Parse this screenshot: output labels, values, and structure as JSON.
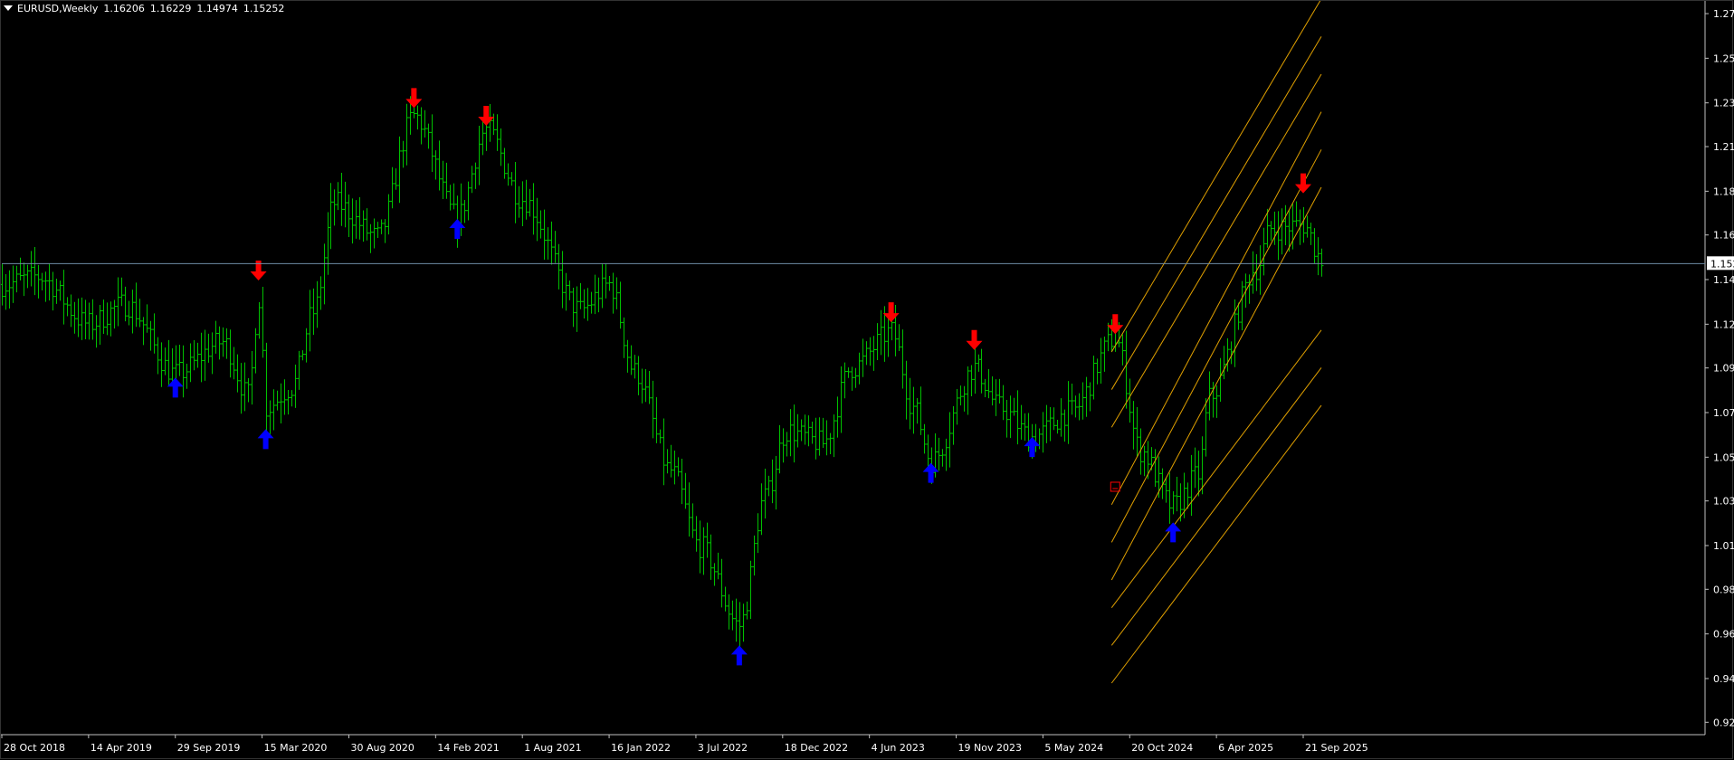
{
  "header": {
    "symbol_timeframe": "EURUSD,Weekly",
    "ohlc": [
      "1.16206",
      "1.16229",
      "1.14974",
      "1.15252"
    ]
  },
  "colors": {
    "background": "#000000",
    "candles": "#00C000",
    "axis": "#C0C0C0",
    "grid_text": "#FFFFFF",
    "current_price_line": "#6E8BA6",
    "up_arrow": "#0000FF",
    "down_arrow": "#FF0000",
    "channel_lines": "#E0A000"
  },
  "chart_data": {
    "type": "ohlc-bar",
    "symbol": "EURUSD",
    "timeframe": "Weekly",
    "current_price": "1.15252",
    "ylim": [
      0.915,
      1.2845
    ],
    "y_ticks": [
      "1.27855",
      "1.25605",
      "1.23355",
      "1.21150",
      "1.18900",
      "1.16695",
      "1.14445",
      "1.12195",
      "1.09990",
      "1.07740",
      "1.05490",
      "1.03285",
      "1.01035",
      "0.98830",
      "0.96580",
      "0.94330",
      "0.92125"
    ],
    "x_ticks": [
      "28 Oct 2018",
      "14 Apr 2019",
      "29 Sep 2019",
      "15 Mar 2020",
      "30 Aug 2020",
      "14 Feb 2021",
      "1 Aug 2021",
      "16 Jan 2022",
      "3 Jul 2022",
      "18 Dec 2022",
      "4 Jun 2023",
      "19 Nov 2023",
      "5 May 2024",
      "20 Oct 2024",
      "6 Apr 2025",
      "21 Sep 2025"
    ],
    "waypoints": [
      {
        "date": "2018-10-28",
        "price": 1.142
      },
      {
        "date": "2019-01-06",
        "price": 1.146
      },
      {
        "date": "2019-04-14",
        "price": 1.122
      },
      {
        "date": "2019-06-23",
        "price": 1.132
      },
      {
        "date": "2019-09-29",
        "price": 1.097
      },
      {
        "date": "2019-12-29",
        "price": 1.113
      },
      {
        "date": "2020-02-16",
        "price": 1.086
      },
      {
        "date": "2020-03-08",
        "price": 1.135
      },
      {
        "date": "2020-03-22",
        "price": 1.08
      },
      {
        "date": "2020-05-10",
        "price": 1.09
      },
      {
        "date": "2020-06-21",
        "price": 1.128
      },
      {
        "date": "2020-08-02",
        "price": 1.183
      },
      {
        "date": "2020-10-25",
        "price": 1.166
      },
      {
        "date": "2021-01-03",
        "price": 1.227
      },
      {
        "date": "2021-03-28",
        "price": 1.176
      },
      {
        "date": "2021-05-23",
        "price": 1.22
      },
      {
        "date": "2021-08-01",
        "price": 1.185
      },
      {
        "date": "2021-11-21",
        "price": 1.129
      },
      {
        "date": "2022-01-16",
        "price": 1.142
      },
      {
        "date": "2022-03-06",
        "price": 1.098
      },
      {
        "date": "2022-05-15",
        "price": 1.048
      },
      {
        "date": "2022-07-10",
        "price": 1.01
      },
      {
        "date": "2022-09-25",
        "price": 0.97
      },
      {
        "date": "2022-11-13",
        "price": 1.035
      },
      {
        "date": "2022-12-25",
        "price": 1.068
      },
      {
        "date": "2023-03-05",
        "price": 1.062
      },
      {
        "date": "2023-04-30",
        "price": 1.1
      },
      {
        "date": "2023-07-16",
        "price": 1.118
      },
      {
        "date": "2023-08-27",
        "price": 1.08
      },
      {
        "date": "2023-10-01",
        "price": 1.053
      },
      {
        "date": "2023-12-24",
        "price": 1.1
      },
      {
        "date": "2024-02-11",
        "price": 1.08
      },
      {
        "date": "2024-04-14",
        "price": 1.065
      },
      {
        "date": "2024-06-30",
        "price": 1.078
      },
      {
        "date": "2024-09-22",
        "price": 1.115
      },
      {
        "date": "2024-11-10",
        "price": 1.058
      },
      {
        "date": "2025-01-12",
        "price": 1.03
      },
      {
        "date": "2025-03-02",
        "price": 1.046
      },
      {
        "date": "2025-03-23",
        "price": 1.085
      },
      {
        "date": "2025-06-22",
        "price": 1.15
      },
      {
        "date": "2025-07-20",
        "price": 1.17
      },
      {
        "date": "2025-09-21",
        "price": 1.172
      },
      {
        "date": "2025-10-26",
        "price": 1.155
      }
    ],
    "signals": [
      {
        "type": "up",
        "date": "2019-09-29",
        "price": 1.09
      },
      {
        "type": "up",
        "date": "2020-03-22",
        "price": 1.064
      },
      {
        "type": "down",
        "date": "2020-03-08",
        "price": 1.149
      },
      {
        "type": "down",
        "date": "2021-01-03",
        "price": 1.236
      },
      {
        "type": "up",
        "date": "2021-03-28",
        "price": 1.17
      },
      {
        "type": "down",
        "date": "2021-05-23",
        "price": 1.227
      },
      {
        "type": "up",
        "date": "2022-09-25",
        "price": 0.955
      },
      {
        "type": "down",
        "date": "2023-07-16",
        "price": 1.128
      },
      {
        "type": "up",
        "date": "2023-10-01",
        "price": 1.047
      },
      {
        "type": "down",
        "date": "2023-12-24",
        "price": 1.114
      },
      {
        "type": "up",
        "date": "2024-04-14",
        "price": 1.06
      },
      {
        "type": "down",
        "date": "2024-09-22",
        "price": 1.122
      },
      {
        "type": "up",
        "date": "2025-01-12",
        "price": 1.017
      },
      {
        "type": "down",
        "date": "2025-09-21",
        "price": 1.193
      }
    ],
    "channel": {
      "start_date": "2024-09-15",
      "end_date": "2025-10-26",
      "lines": [
        {
          "start": 1.089,
          "end": 1.267
        },
        {
          "start": 1.012,
          "end": 1.21
        },
        {
          "start": 0.96,
          "end": 1.1
        }
      ],
      "spacing": 0.019
    }
  }
}
